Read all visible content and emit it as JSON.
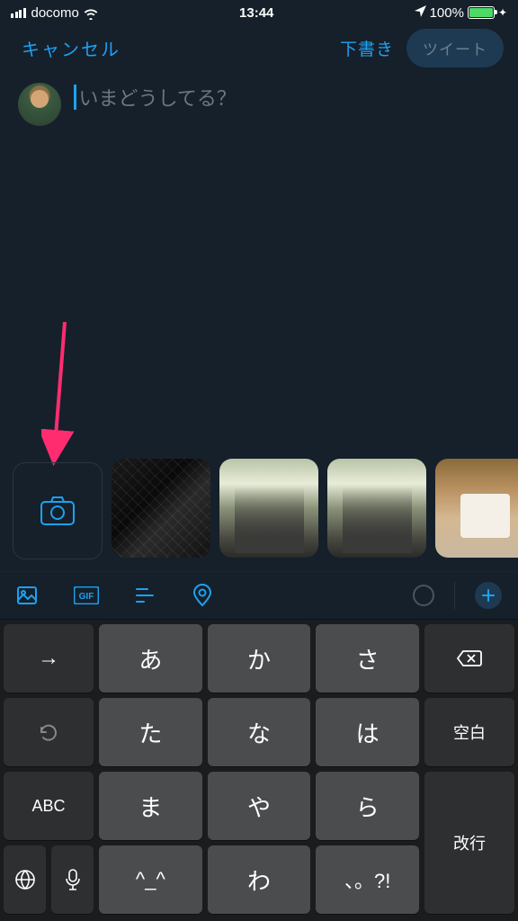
{
  "status": {
    "carrier": "docomo",
    "time": "13:44",
    "battery_pct": "100%"
  },
  "nav": {
    "cancel": "キャンセル",
    "draft": "下書き",
    "tweet": "ツイート"
  },
  "compose": {
    "placeholder": "いまどうしてる？"
  },
  "toolbar": {
    "gif_label": "GIF"
  },
  "keyboard": {
    "rows": [
      {
        "side_left": "→",
        "k1": "あ",
        "k2": "か",
        "k3": "さ",
        "side_right_icon": "backspace"
      },
      {
        "side_left_icon": "undo",
        "k1": "た",
        "k2": "な",
        "k3": "は",
        "side_right": "空白"
      },
      {
        "side_left": "ABC",
        "k1": "ま",
        "k2": "や",
        "k3": "ら",
        "side_right": "改行"
      },
      {
        "side_left_icon": "globe",
        "side_left2_icon": "mic",
        "k1": "^_^",
        "k2": "わ",
        "k3": "、。?!"
      }
    ]
  }
}
